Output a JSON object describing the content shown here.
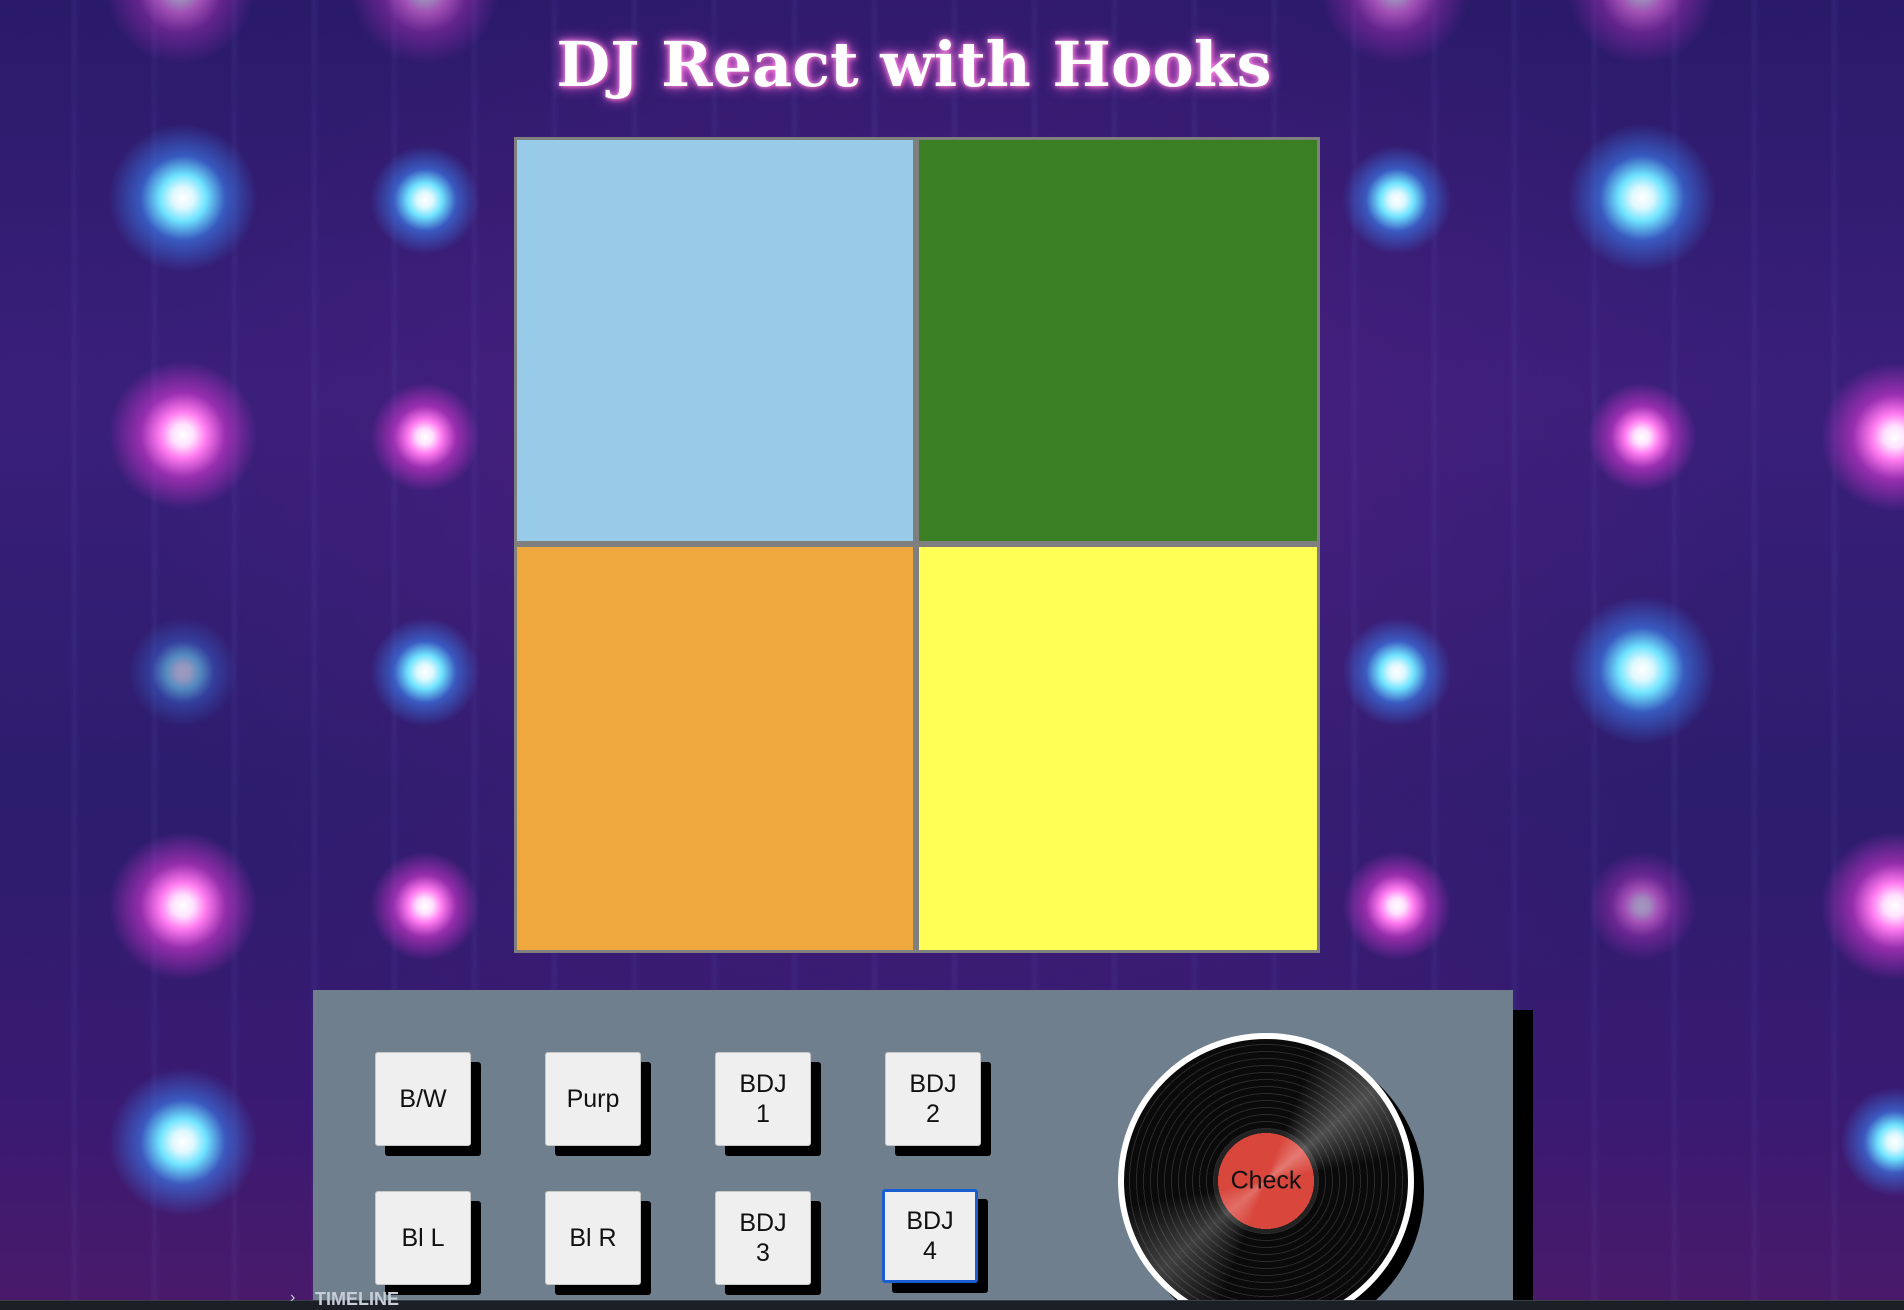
{
  "page": {
    "title": "DJ React with Hooks"
  },
  "pads": [
    {
      "name": "light-blue-pad",
      "color": "#98cbe7"
    },
    {
      "name": "green-pad",
      "color": "#3a7f23"
    },
    {
      "name": "orange-pad",
      "color": "#eea83e"
    },
    {
      "name": "yellow-pad",
      "color": "#ffff55"
    }
  ],
  "controls": {
    "buttons": [
      {
        "label": "B/W"
      },
      {
        "label": "Purp"
      },
      {
        "label": "BDJ\n1"
      },
      {
        "label": "BDJ\n2"
      },
      {
        "label": "Bl L"
      },
      {
        "label": "Bl R"
      },
      {
        "label": "BDJ\n3"
      },
      {
        "label": "BDJ\n4"
      }
    ],
    "record_label": "Check",
    "record_color": "#d9463c",
    "focused_button": "BDJ 4"
  },
  "bottom_bar": {
    "label": "TIMELINE"
  },
  "colors": {
    "panel": "#707f8e",
    "background": "#2c1d6e",
    "focus_ring": "#1a5fd0"
  }
}
